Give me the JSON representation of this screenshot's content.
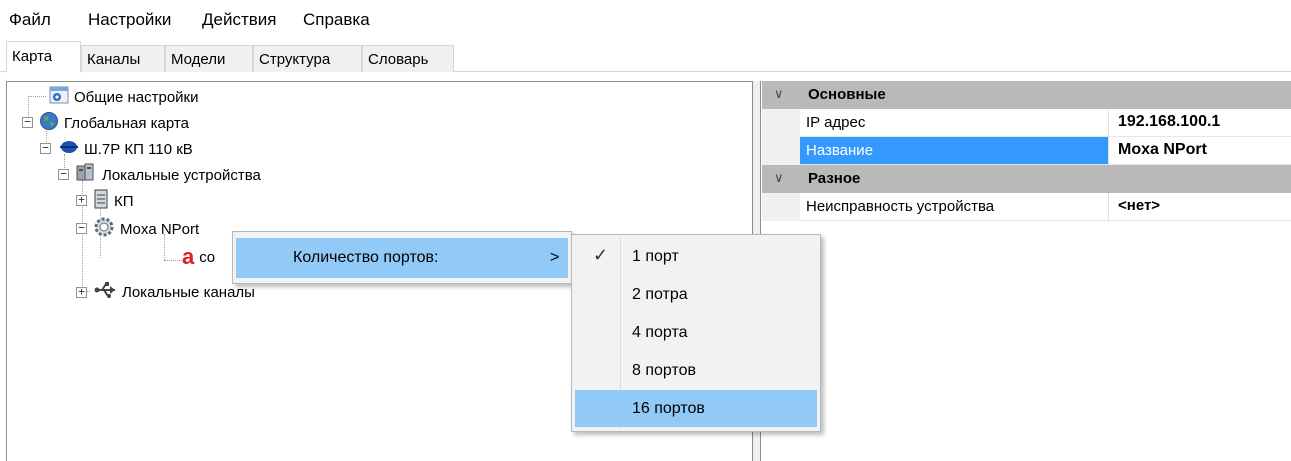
{
  "menubar": {
    "file": "Файл",
    "settings": "Настройки",
    "actions": "Действия",
    "help": "Справка"
  },
  "tabs": [
    {
      "label": "Карта",
      "active": true
    },
    {
      "label": "Каналы",
      "active": false
    },
    {
      "label": "Модели",
      "active": false
    },
    {
      "label": "Структура",
      "active": false
    },
    {
      "label": "Словарь",
      "active": false
    }
  ],
  "tree": {
    "general_settings": "Общие настройки",
    "global_map": "Глобальная карта",
    "object": "Ш.7Р КП 110 кВ",
    "local_devices": "Локальные устройства",
    "kp": "КП",
    "moxa": "Moxa NPort",
    "moxa_child": "co",
    "local_channels": "Локальные каналы"
  },
  "props": {
    "cat_main": "Основные",
    "ip_label": "IP адрес",
    "ip_value": "192.168.100.1",
    "name_label": "Название",
    "name_value": "Moxa NPort",
    "cat_misc": "Разное",
    "fault_label": "Неисправность устройства",
    "fault_value": "<нет>"
  },
  "context_menu": {
    "item": "Количество портов:",
    "arrow": ">"
  },
  "submenu": {
    "options": [
      "1 порт",
      "2 потра",
      "4 порта",
      "8 портов",
      "16 портов"
    ],
    "checked_index": 0,
    "highlighted_index": 4
  },
  "colors": {
    "selection": "#3399ff",
    "menu_highlight": "#91c9f7",
    "category_bg": "#f0f0f0"
  }
}
